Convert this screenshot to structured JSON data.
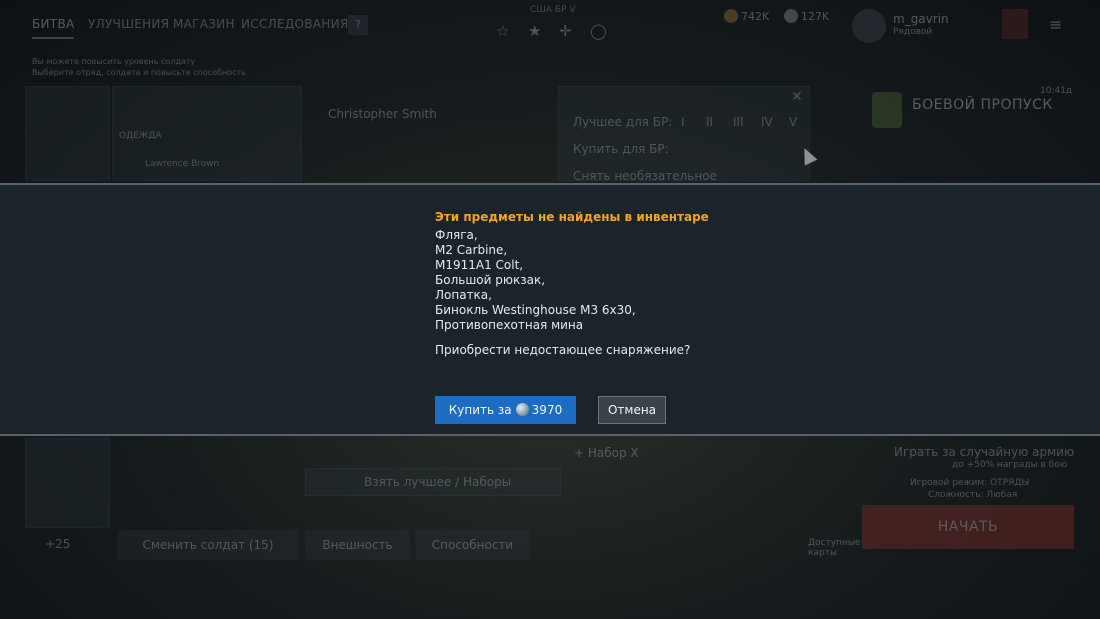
{
  "nav": {
    "tabs": [
      "БИТВА",
      "УЛУЧШЕНИЯ",
      "МАГАЗИН",
      "ИССЛЕДОВАНИЯ"
    ],
    "help_label": "?",
    "mode_label": "США БР V"
  },
  "header": {
    "gold": "742K",
    "silver": "127K",
    "username": "m_gavrin",
    "rank": "Рядовой"
  },
  "hint": {
    "line1": "Вы можете повысить уровень солдату",
    "line2": "Выберите отряд, солдата и повысьте способность"
  },
  "left_panel": {
    "section_label": "ОДЕЖДА",
    "soldier_name": "Lawrence Brown",
    "soldier_sub": "Christopher Smith"
  },
  "loadout": {
    "best_for_br": "Лучшее для БР:",
    "buy_for_br": "Купить для БР:",
    "remove_optional": "Снять необязательное",
    "levels": [
      "I",
      "II",
      "III",
      "IV",
      "V"
    ]
  },
  "battlepass": {
    "title": "БОЕВОЙ ПРОПУСК",
    "time": "10:41д"
  },
  "bottom": {
    "take_best": "Взять лучшее / Наборы",
    "change_soldier": "Сменить солдат (15)",
    "appearance": "Внешность",
    "abilities": "Способности",
    "random_army": "Играть за случайную армию",
    "random_bonus": "до +50% награды в бою",
    "game_mode": "Игровой режим: ОТРЯДЫ",
    "difficulty": "Сложность: Любая",
    "start": "НАЧАТЬ",
    "available_maps": "Доступные карты",
    "kit": "+ Набор X",
    "squad_count": "+25"
  },
  "dialog": {
    "title": "Эти предметы не найдены в инвентаре",
    "items": [
      "Фляга,",
      "M2 Carbine,",
      "M1911A1 Colt,",
      "Большой рюкзак,",
      "Лопатка,",
      "Бинокль Westinghouse M3 6x30,",
      "Противопехотная мина"
    ],
    "question": "Приобрести недостающее снаряжение?",
    "buy_label": "Купить за",
    "buy_price": "3970",
    "cancel_label": "Отмена"
  },
  "colors": {
    "title_accent": "#f0a428",
    "buy_button": "#1e6bc2",
    "dialog_bg": "#1b232b"
  }
}
